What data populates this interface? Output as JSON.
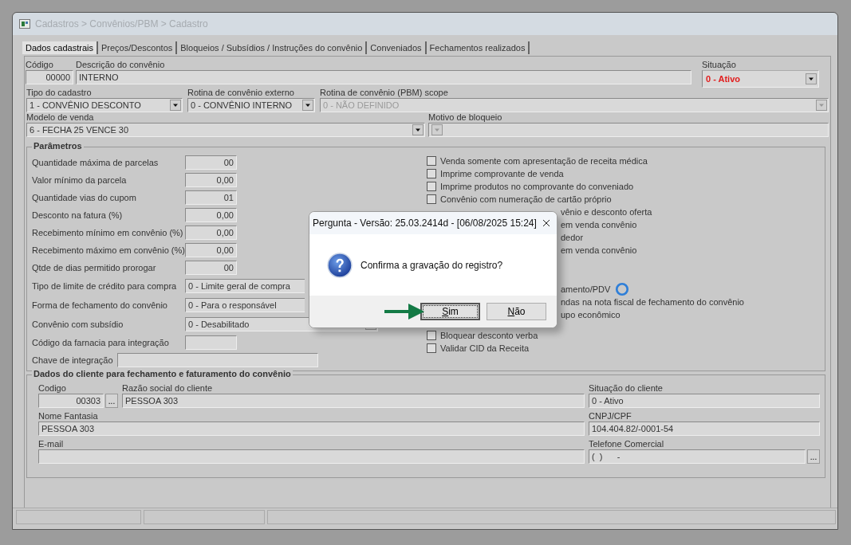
{
  "window": {
    "title": "Cadastros > Convênios/PBM > Cadastro"
  },
  "tabs": [
    {
      "label": "Dados cadastrais",
      "selected": true
    },
    {
      "label": "Preços/Descontos",
      "selected": false
    },
    {
      "label": "Bloqueios / Subsídios / Instruções do convênio",
      "selected": false
    },
    {
      "label": "Conveniados",
      "selected": false
    },
    {
      "label": "Fechamentos realizados",
      "selected": false
    }
  ],
  "general": {
    "codigo": {
      "label": "Código",
      "value": "00000"
    },
    "descricao": {
      "label": "Descrição do convênio",
      "value": "INTERNO"
    },
    "situacao": {
      "label": "Situação",
      "value": "0 - Ativo"
    },
    "tipo_cadastro": {
      "label": "Tipo do cadastro",
      "value": "1 - CONVÊNIO DESCONTO",
      "disabled": false
    },
    "rotina_externo": {
      "label": "Rotina de convênio externo",
      "value": "0 - CONVÊNIO INTERNO",
      "disabled": false
    },
    "rotina_pbm": {
      "label": "Rotina de convênio (PBM) scope",
      "value": "0 - NÃO DEFINIDO",
      "disabled": true
    },
    "modelo_venda": {
      "label": "Modelo de venda",
      "value": "6 - FECHA 25 VENCE 30",
      "disabled": false
    },
    "motivo_bloqueio": {
      "label": "Motivo de bloqueio",
      "disabled": true
    }
  },
  "parameters": {
    "title": "Parâmetros",
    "numeric": [
      {
        "label": "Quantidade máxima de parcelas",
        "value": "00"
      },
      {
        "label": "Valor mínimo da parcela",
        "value": "0,00"
      },
      {
        "label": "Quantidade vias do cupom",
        "value": "01"
      },
      {
        "label": "Desconto na fatura (%)",
        "value": "0,00"
      },
      {
        "label": "Recebimento mínimo em convênio (%)",
        "value": "0,00"
      },
      {
        "label": "Recebimento máximo em convênio (%)",
        "value": "0,00"
      },
      {
        "label": "Qtde de dias permitido prorogar",
        "value": "00"
      }
    ],
    "selects": [
      {
        "label": "Tipo de limite de crédito para compra",
        "value": "0 - Limite geral de compra",
        "covered": true
      },
      {
        "label": "Forma de fechamento do convênio",
        "value": "0 - Para o responsável",
        "covered": true
      },
      {
        "label": "Convênio com subsídio",
        "value": "0 - Desabilitado",
        "covered": false
      }
    ],
    "codigo_farmacia": {
      "label": "Código da farnacia para integração"
    },
    "chave_integracao": {
      "label": "Chave de integração"
    },
    "options": [
      {
        "label": "Venda somente com apresentação de receita médica",
        "checked": false,
        "covered": false
      },
      {
        "label": "Imprime comprovante de venda",
        "checked": false,
        "covered": false
      },
      {
        "label": "Imprime produtos no comprovante do conveniado",
        "checked": false,
        "covered": false
      },
      {
        "label": "Convênio com numeração de cartão próprio",
        "checked": false,
        "covered": false
      },
      {
        "label": "vênio e desconto oferta",
        "covered": true
      },
      {
        "label": "em venda convênio",
        "covered": true
      },
      {
        "label": "dedor",
        "covered": true
      },
      {
        "label": "em venda convênio",
        "covered": true
      },
      {
        "label": "amento/PDV",
        "covered": true
      },
      {
        "label": "ndas na nota fiscal de fechamento do convênio",
        "covered": true
      },
      {
        "label": "upo econômico",
        "covered": true
      },
      {
        "label": "Bloquear desconto verba",
        "checked": false,
        "covered": false
      },
      {
        "label": "Validar CID da Receita",
        "checked": false,
        "covered": false
      }
    ],
    "loading": true
  },
  "client": {
    "title": "Dados do cliente para fechamento e faturamento do convênio",
    "codigo": {
      "label": "Codigo",
      "value": "00303",
      "button": "..."
    },
    "razao": {
      "label": "Razão social do cliente",
      "value": "PESSOA 303"
    },
    "situacao": {
      "label": "Situação do cliente",
      "value": "0 - Ativo"
    },
    "fantasia": {
      "label": "Nome Fantasia",
      "value": "PESSOA 303"
    },
    "cnpj": {
      "label": "CNPJ/CPF",
      "value": "104.404.82/-0001-54"
    },
    "email": {
      "label": "E-mail"
    },
    "telefone": {
      "label": "Telefone Comercial",
      "value": "(  )      -",
      "button": "..."
    }
  },
  "dialog": {
    "title": "Pergunta - Versão: 25.03.2414d - [06/08/2025 15:24]",
    "message": "Confirma a gravação do registro?",
    "buttons": [
      {
        "label": "Sim",
        "focused": true
      },
      {
        "label": "Não",
        "focused": false
      }
    ],
    "pointer_arrow": true
  }
}
